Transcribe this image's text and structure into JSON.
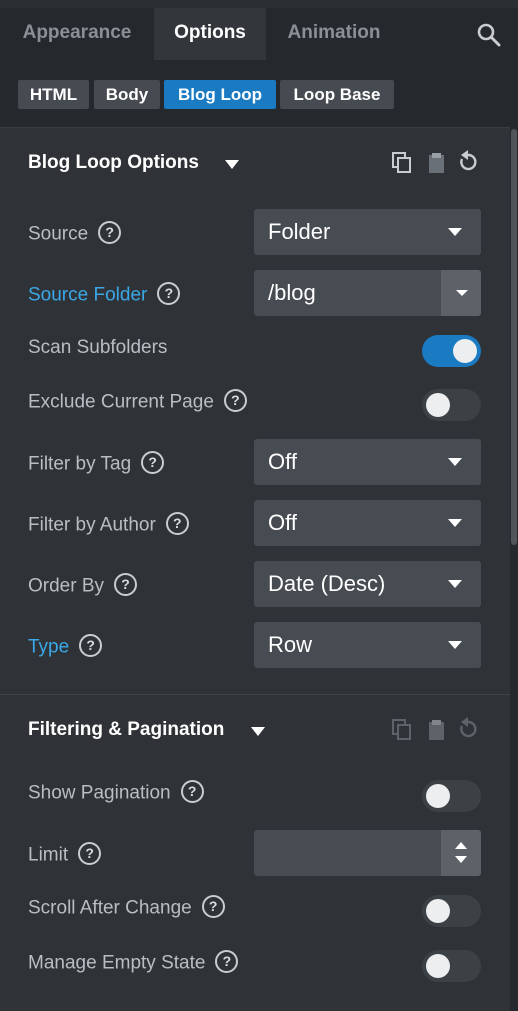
{
  "tabs": [
    {
      "label": "Appearance",
      "active": false
    },
    {
      "label": "Options",
      "active": true
    },
    {
      "label": "Animation",
      "active": false
    }
  ],
  "subtabs": [
    {
      "label": "HTML",
      "active": false
    },
    {
      "label": "Body",
      "active": false
    },
    {
      "label": "Blog Loop",
      "active": true
    },
    {
      "label": "Loop Base",
      "active": false
    }
  ],
  "section1": {
    "title": "Blog Loop Options",
    "source": {
      "label": "Source",
      "value": "Folder"
    },
    "source_folder": {
      "label": "Source Folder",
      "value": "/blog"
    },
    "scan_subfolders": {
      "label": "Scan Subfolders",
      "on": true
    },
    "exclude_current": {
      "label": "Exclude Current Page",
      "on": false
    },
    "filter_tag": {
      "label": "Filter by Tag",
      "value": "Off"
    },
    "filter_author": {
      "label": "Filter by Author",
      "value": "Off"
    },
    "order_by": {
      "label": "Order By",
      "value": "Date (Desc)"
    },
    "type": {
      "label": "Type",
      "value": "Row"
    }
  },
  "section2": {
    "title": "Filtering & Pagination",
    "show_pagination": {
      "label": "Show Pagination",
      "on": false
    },
    "limit": {
      "label": "Limit",
      "value": ""
    },
    "scroll_after_change": {
      "label": "Scroll After Change",
      "on": false
    },
    "manage_empty_state": {
      "label": "Manage Empty State",
      "on": false
    }
  },
  "help_glyph": "?",
  "colors": {
    "accent": "#1a7ac2",
    "link_label": "#3aa8e8",
    "panel": "#2f3337",
    "tabbar": "#25282c"
  },
  "icons": [
    "search-icon",
    "copy-icon",
    "paste-icon",
    "reset-icon",
    "caret-down-icon",
    "help-icon"
  ]
}
